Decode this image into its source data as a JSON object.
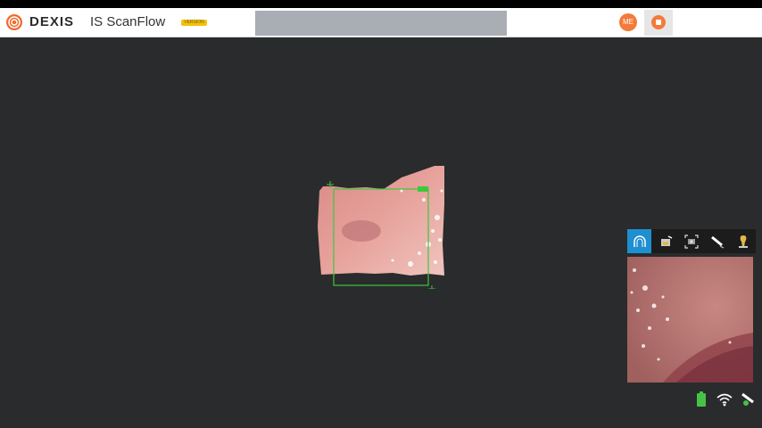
{
  "app": {
    "brand": "DEXIS",
    "product": "IS ScanFlow",
    "badge": "VERSION"
  },
  "header": {
    "user_initials": "ME",
    "record_icon": "record-stop-icon"
  },
  "toolbar": {
    "tools": [
      {
        "name": "arch-tool",
        "icon": "arch-icon",
        "active": true
      },
      {
        "name": "scan-tool",
        "icon": "scanner-icon",
        "active": false
      },
      {
        "name": "capture-tool",
        "icon": "camera-frame-icon",
        "active": false
      },
      {
        "name": "light-tool",
        "icon": "light-wand-icon",
        "active": false
      },
      {
        "name": "tooth-tool",
        "icon": "tooth-icon",
        "active": false
      }
    ]
  },
  "status_bar": {
    "battery": "battery-icon",
    "wifi": "wifi-icon",
    "scanner": "scanner-status-icon"
  },
  "colors": {
    "background": "#2a2b2c",
    "accent": "#1e8fd0",
    "brand_orange": "#f47a3a",
    "tracking_box": "#33cc33"
  }
}
